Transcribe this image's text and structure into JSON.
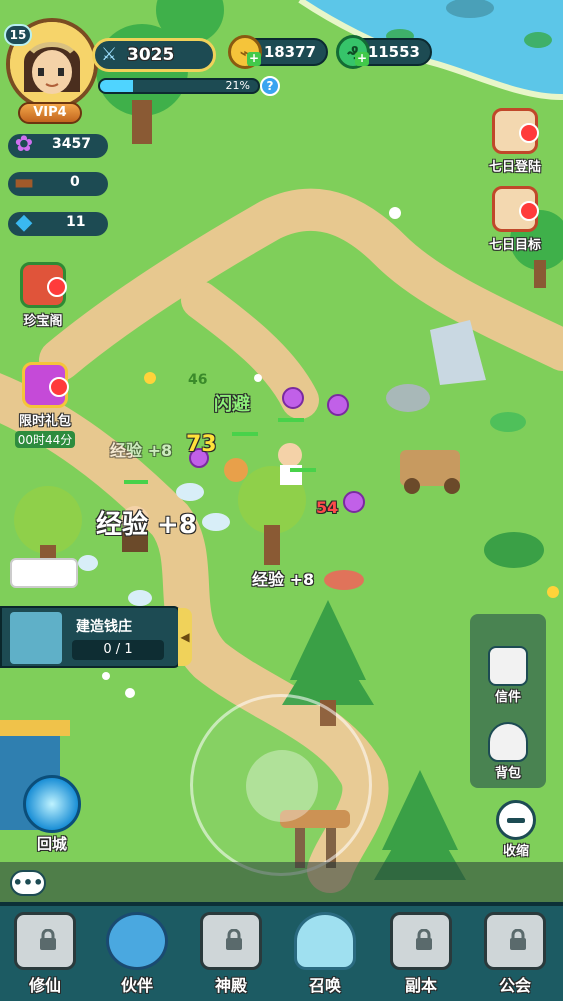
{
  "player": {
    "level": "15",
    "vip": "VIP4",
    "power": "3025",
    "exp_percent": "21%",
    "exp_fraction": 0.21
  },
  "currencies": {
    "coins": "18377",
    "jade": "11553"
  },
  "resources": {
    "spirit": "3457",
    "wood": "0",
    "crystal": "11"
  },
  "right_buttons": {
    "seven_day_login": "七日登陆",
    "seven_day_goal": "七日目标"
  },
  "left_buttons": {
    "treasure_pavilion": "珍宝阁",
    "limited_gift": "限时礼包",
    "gift_timer": "00时44分"
  },
  "build_task": {
    "title": "建造钱庄",
    "progress": "0 / 1"
  },
  "floating_text": {
    "exp_big": "经验 +8",
    "exp_small_1": "经验 +8",
    "exp_small_2": "经验 +8",
    "dodge": "闪避",
    "dmg_73": "73",
    "dmg_54": "54",
    "dmg_46": "46"
  },
  "panel": {
    "mail": "信件",
    "bag": "背包",
    "collapse": "收缩"
  },
  "return_city": "回城",
  "chat_icon": "•••",
  "bottom_nav": [
    {
      "label": "修仙"
    },
    {
      "label": "伙伴"
    },
    {
      "label": "神殿"
    },
    {
      "label": "召唤"
    },
    {
      "label": "副本"
    },
    {
      "label": "公会"
    }
  ],
  "colors": {
    "grass": "#7fcf5a",
    "path": "#e7c88f",
    "water": "#5cc6e8",
    "hud_dark": "#1d4b53",
    "gold": "#f0d25a",
    "nav_bg": "#1c5b63"
  }
}
